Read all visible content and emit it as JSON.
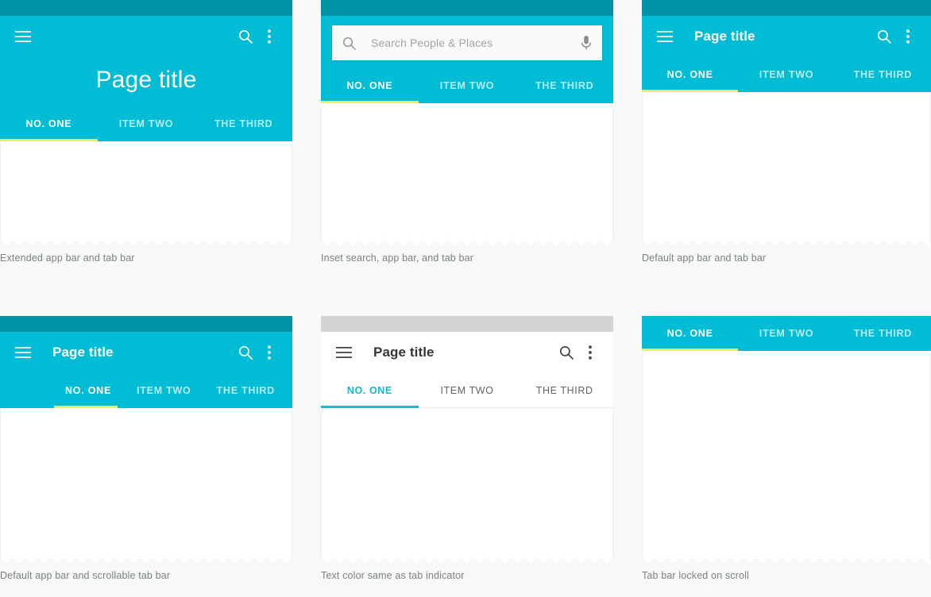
{
  "colors": {
    "app_bar_teal": "#00bcd4",
    "status_bar_teal": "#0093a6",
    "status_bar_grey": "#d2d4d6",
    "indicator_yellow": "#e6ea7a",
    "indicator_teal": "#26b6c9",
    "page_background": "#f7f8f8",
    "caption_text": "#7d8183",
    "dark_title_text": "#33373a"
  },
  "tabs": {
    "one": "NO. ONE",
    "two": "ITEM TWO",
    "three": "THE THIRD"
  },
  "panels": [
    {
      "id": "extended-app-bar",
      "title": "Page title",
      "caption": "Extended app bar and tab bar"
    },
    {
      "id": "inset-search",
      "search_placeholder": "Search People  & Places",
      "caption": "Inset search, app bar, and tab bar"
    },
    {
      "id": "default-app-bar",
      "title": "Page title",
      "caption": "Default app bar and tab bar"
    },
    {
      "id": "scrollable-tab-bar",
      "title": "Page title",
      "caption": "Default app bar and scrollable tab bar"
    },
    {
      "id": "white-app-bar",
      "title": "Page title",
      "caption": "Text color same as tab indicator"
    },
    {
      "id": "locked-tab-bar",
      "caption": "Tab bar locked on scroll"
    }
  ]
}
